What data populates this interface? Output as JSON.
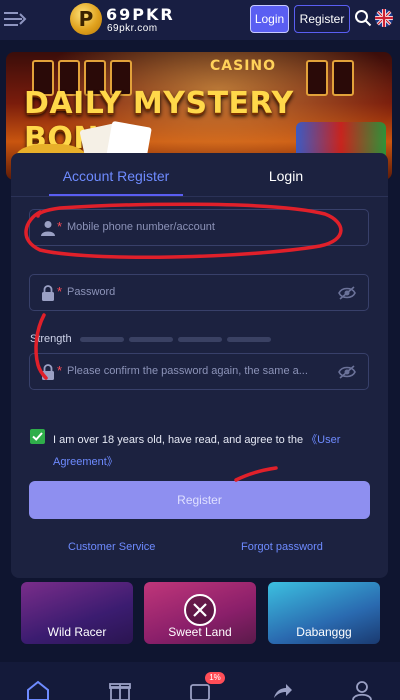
{
  "header": {
    "logo_name": "69PKR",
    "logo_domain": "69pkr.com",
    "logo_badge": "P",
    "login_label": "Login",
    "register_label": "Register",
    "language_icon": "uk-flag-icon"
  },
  "banner": {
    "casino_text": "CASINO",
    "title": "DAILY MYSTERY BONUS"
  },
  "modal": {
    "tabs": [
      {
        "label": "Account Register",
        "active": true
      },
      {
        "label": "Login",
        "active": false
      }
    ],
    "account_field": {
      "required_mark": "*",
      "placeholder": "Mobile phone number/account",
      "icon": "user-icon"
    },
    "password_field": {
      "required_mark": "*",
      "placeholder": "Password",
      "icon": "lock-icon"
    },
    "strength_label": "Strength",
    "strength_segments": 4,
    "confirm_field": {
      "required_mark": "*",
      "placeholder": "Please confirm the password again, the same a...",
      "icon": "lock-icon"
    },
    "agreement": {
      "checked": true,
      "text": "I am over 18 years old, have read, and agree to the ",
      "link": "《User Agreement》"
    },
    "register_button": "Register",
    "customer_service": "Customer Service",
    "forgot_password": "Forgot password"
  },
  "games": [
    {
      "name": "Wild Racer"
    },
    {
      "name": "Sweet Land"
    },
    {
      "name": "Dabanggg"
    }
  ],
  "bottom_nav": {
    "items": [
      "home-icon",
      "gift-icon",
      "wallet-icon",
      "share-icon",
      "profile-icon"
    ],
    "badge": "1%"
  },
  "colors": {
    "accent": "#5a5ef2",
    "link": "#6e8bff",
    "required": "#ff4d57",
    "annotation": "#e0202a"
  }
}
